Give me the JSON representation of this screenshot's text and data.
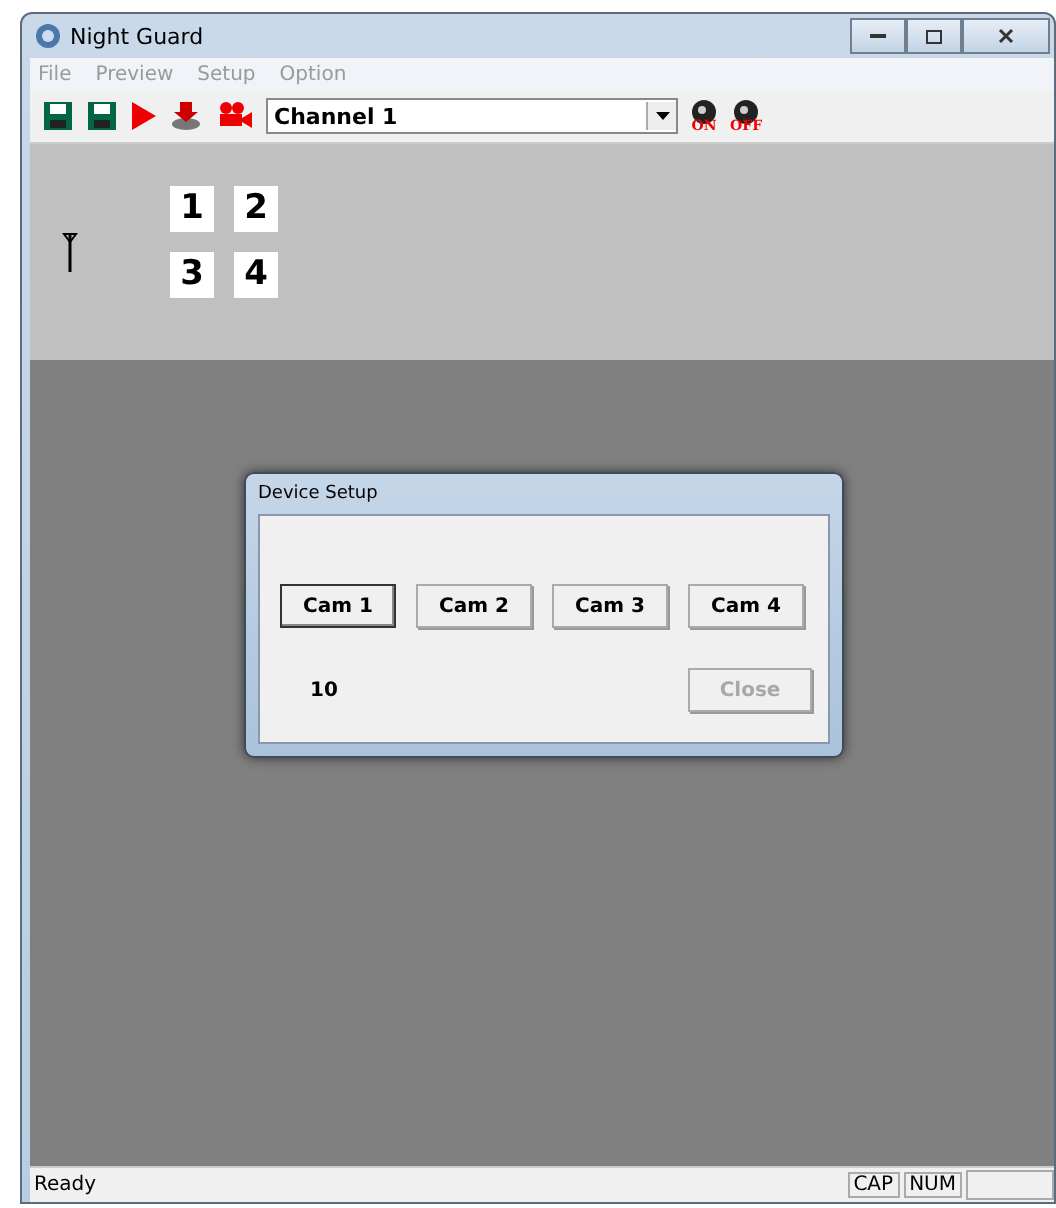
{
  "window": {
    "title": "Night Guard"
  },
  "menu": [
    {
      "label": "File"
    },
    {
      "label": "Preview"
    },
    {
      "label": "Setup"
    },
    {
      "label": "Option"
    }
  ],
  "toolbar": {
    "channel": "Channel 1",
    "record_on": "ON",
    "record_off": "OFF"
  },
  "channels": [
    "1",
    "2",
    "3",
    "4"
  ],
  "dialog": {
    "title": "Device Setup",
    "buttons": [
      {
        "label": "Cam 1",
        "focused": true
      },
      {
        "label": "Cam 2",
        "focused": false
      },
      {
        "label": "Cam 3",
        "focused": false
      },
      {
        "label": "Cam 4",
        "focused": false
      }
    ],
    "count": "10",
    "close": {
      "label": "Close",
      "disabled": true
    }
  },
  "status_bar": {
    "text": "Ready",
    "indicators": [
      "CAP",
      "NUM"
    ]
  }
}
